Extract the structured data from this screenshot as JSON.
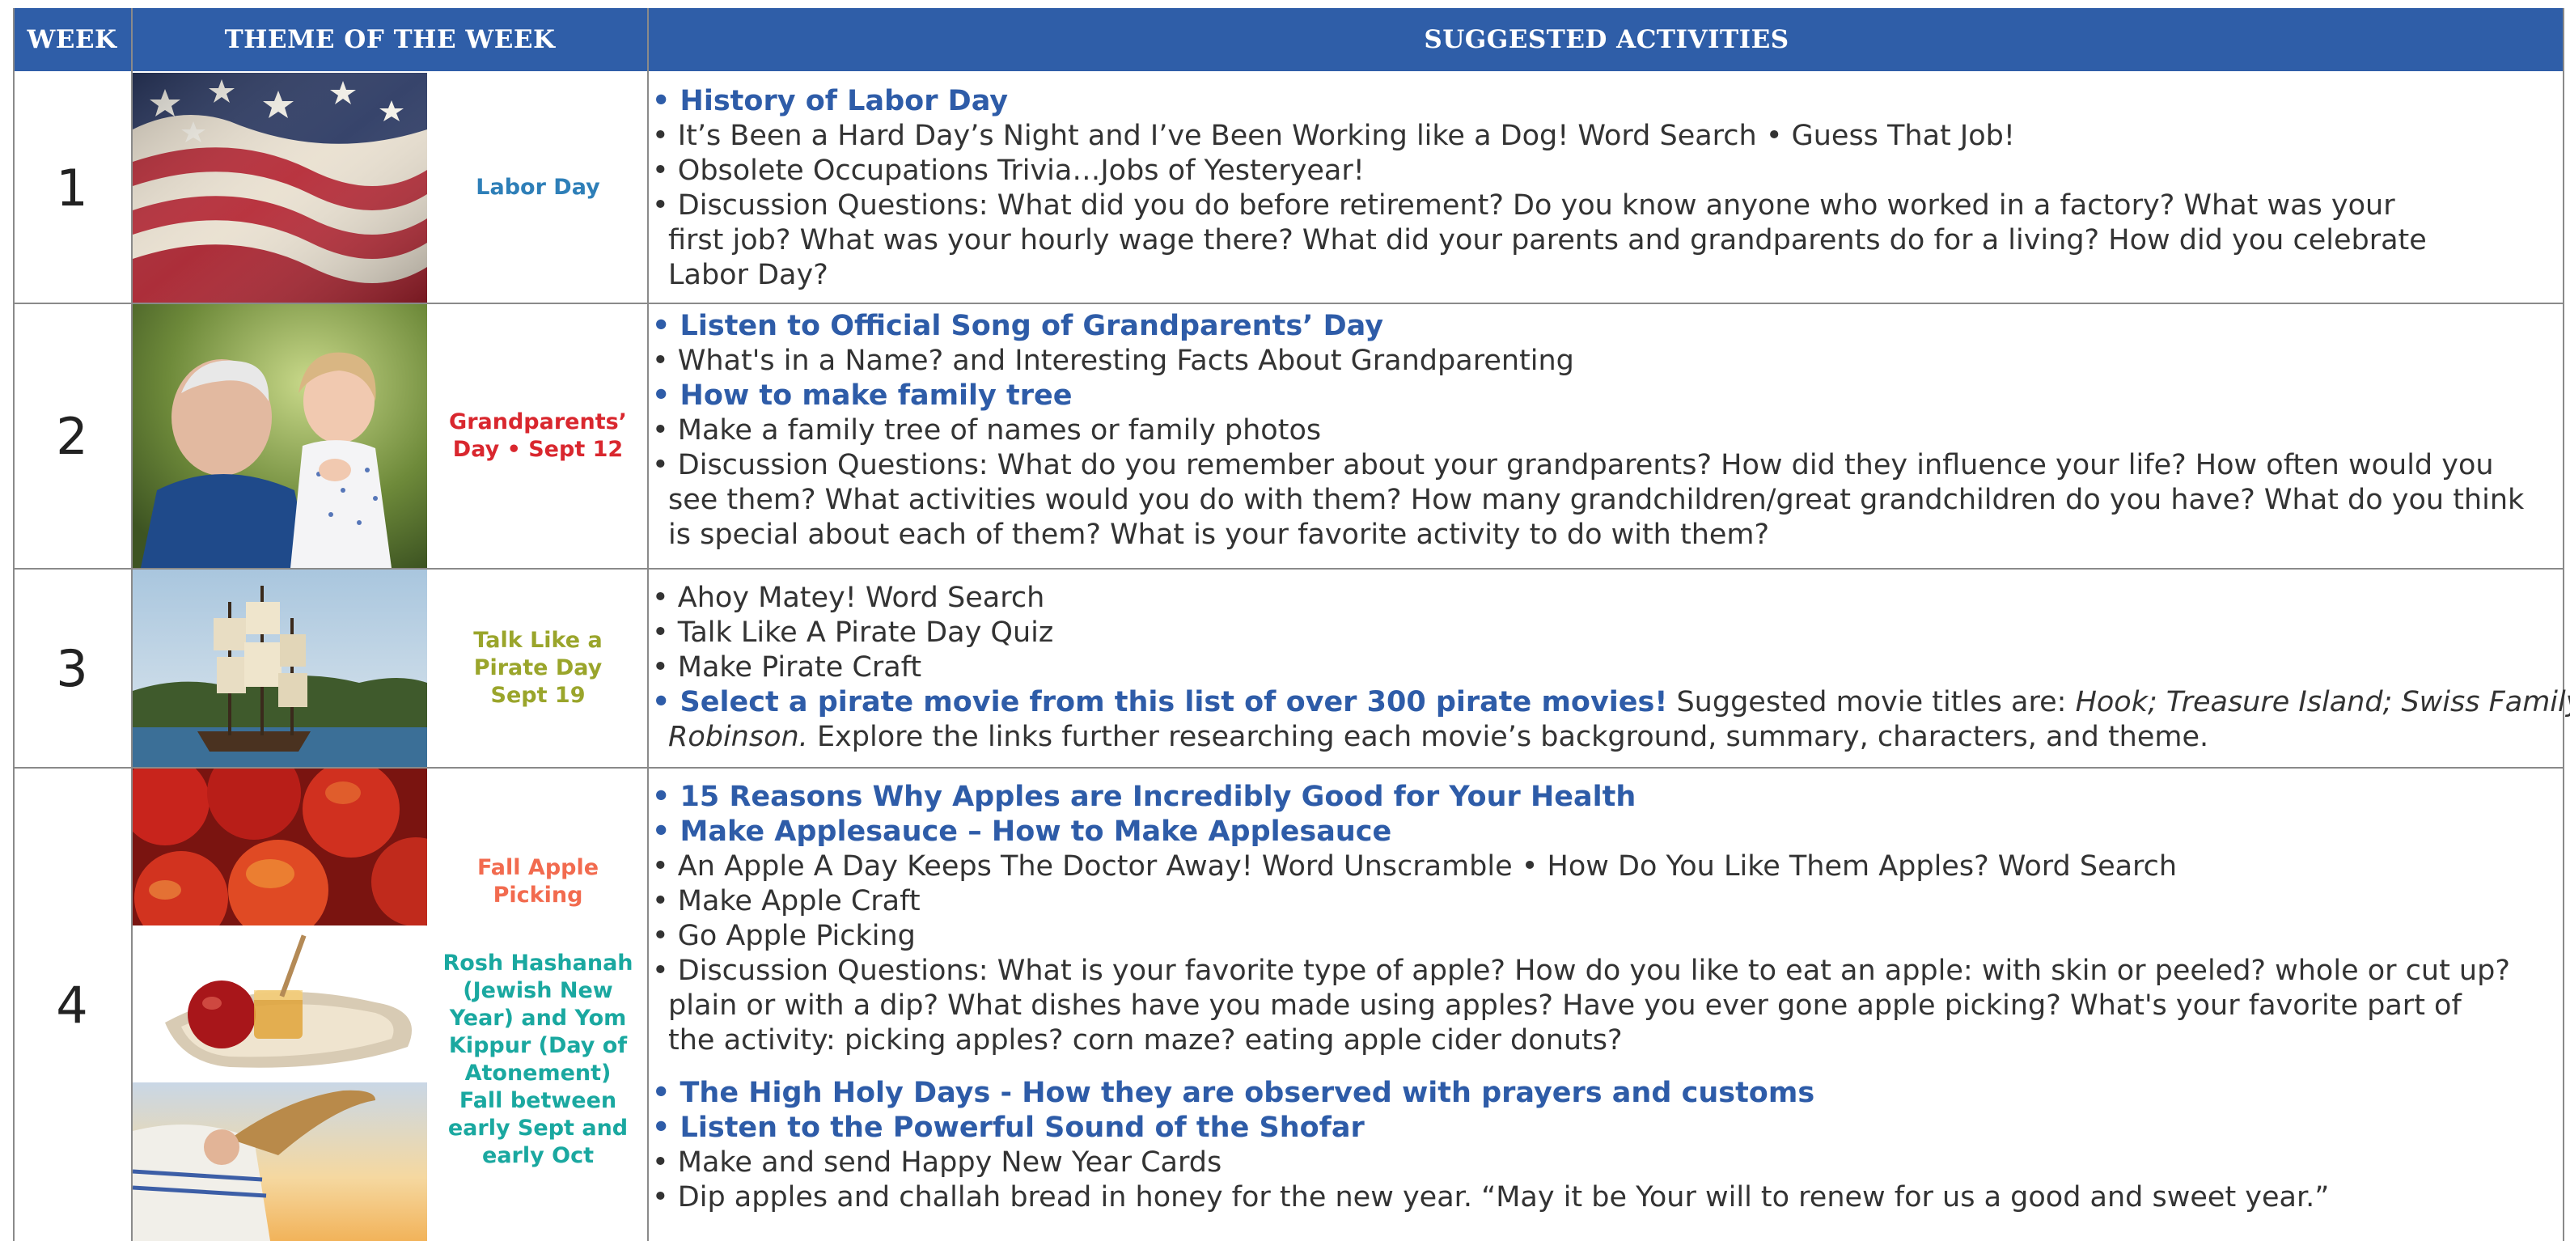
{
  "header": {
    "week": "WEEK",
    "theme": "THEME OF THE WEEK",
    "activities": "SUGGESTED ACTIVITIES"
  },
  "colors": {
    "header_bg": "#2f5ea8",
    "link_blue": "#2e5ca8",
    "labor_day": "#2e7fb8",
    "grandparents": "#d9272e",
    "pirate": "#9aa52b",
    "apple": "#f26b4f",
    "rosh": "#1aa8a0"
  },
  "rows": [
    {
      "week": "1",
      "theme": "Labor Day",
      "image": "american-flag-image",
      "lines": [
        "• History of Labor Day",
        "• It’s Been a Hard Day’s Night and I’ve Been Working like a Dog! Word Search • Guess That Job!",
        "• Obsolete Occupations Trivia…Jobs of Yesteryear!",
        "• Discussion Questions: What did you do before retirement? Do you know anyone who worked in a factory? What was your",
        "first job? What was your hourly wage there? What did your parents and grandparents do for a living?  How did you celebrate",
        "Labor Day?"
      ]
    },
    {
      "week": "2",
      "theme_line1": "Grandparents’",
      "theme_line2": "Day • Sept 12",
      "image": "grandfather-and-granddaughter-image",
      "lines": [
        "• Listen to Official Song of Grandparents’ Day",
        "• What's in a Name? and Interesting Facts About Grandparenting",
        "• How to make family tree",
        "• Make a family tree of names or family photos",
        "• Discussion Questions: What do you remember about your grandparents? How did they influence your life? How often would you",
        "see them? What activities would you do with them? How many grandchildren/great grandchildren do you have? What do you think",
        "is special about each of them? What is your favorite activity to do with them?"
      ]
    },
    {
      "week": "3",
      "theme_line1": "Talk Like a",
      "theme_line2": "Pirate Day",
      "theme_line3": "Sept 19",
      "image": "pirate-ship-image",
      "lines": [
        "• Ahoy Matey! Word Search",
        "• Talk Like A Pirate Day Quiz",
        "• Make Pirate Craft"
      ],
      "movie_bold": "• Select a pirate movie from this list of over 300 pirate movies!",
      "movie_text": " Suggested movie titles are: ",
      "movie_titles": "Hook; Treasure Island; Swiss Family",
      "movie_titles2": "Robinson.",
      "movie_rest": " Explore the links further researching each movie’s background, summary, characters, and theme."
    },
    {
      "week": "4",
      "theme_apple_line1": "Fall Apple",
      "theme_apple_line2": "Picking",
      "theme_rosh": [
        "Rosh Hashanah",
        "(Jewish New",
        "Year) and Yom",
        "Kippur (Day of",
        "Atonement)",
        "Fall between",
        "early Sept and",
        "early Oct"
      ],
      "images": [
        "apples-image",
        "honey-and-apple-image",
        "shofar-image"
      ],
      "lines_a": [
        "• 15 Reasons Why Apples are Incredibly Good for Your Health",
        "• Make Applesauce – How to Make Applesauce",
        "• An Apple A Day Keeps The Doctor Away! Word Unscramble • How Do You Like Them Apples? Word Search",
        "• Make Apple Craft",
        "• Go Apple Picking",
        "• Discussion Questions: What is your favorite type of apple? How do you like to eat an apple: with skin or peeled? whole or cut up?",
        "plain or with a dip? What dishes have you made using apples? Have you ever gone apple picking? What's your favorite part of",
        "the activity: picking apples? corn maze? eating apple cider donuts?"
      ],
      "lines_b": [
        "• The High Holy Days - How they are observed with prayers and customs",
        "• Listen to the Powerful Sound of the Shofar",
        "• Make and send Happy New Year Cards",
        "• Dip apples and challah bread in honey for the new year. “May it be Your will to renew for us a good and sweet year.”"
      ]
    }
  ]
}
